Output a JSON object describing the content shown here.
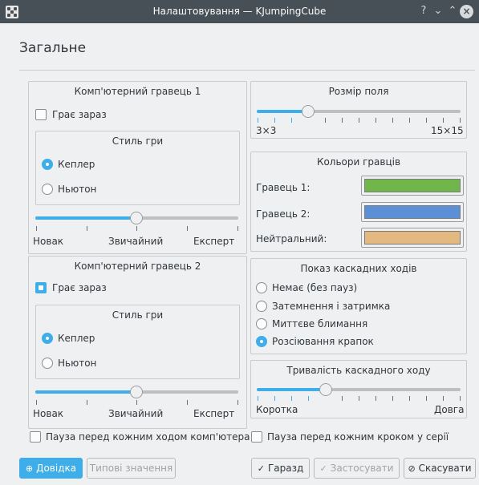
{
  "window": {
    "title": "Налаштовування — KJumpingCube",
    "help_glyph": "?",
    "minimize_glyph": "⌄",
    "maximize_glyph": "⌃",
    "close_glyph": "×"
  },
  "heading": "Загальне",
  "computer_player_1": {
    "title": "Комп'ютерний гравець 1",
    "plays_now_label": "Грає зараз",
    "plays_now_checked": false,
    "style_title": "Стиль гри",
    "options": [
      "Кеплер",
      "Ньютон"
    ],
    "selected": "Кеплер",
    "skill_min_label": "Новак",
    "skill_mid_label": "Звичайний",
    "skill_max_label": "Експерт",
    "skill_level_fraction": 0.5
  },
  "computer_player_2": {
    "title": "Комп'ютерний гравець 2",
    "plays_now_label": "Грає зараз",
    "plays_now_checked": true,
    "style_title": "Стиль гри",
    "options": [
      "Кеплер",
      "Ньютон"
    ],
    "selected": "Кеплер",
    "skill_min_label": "Новак",
    "skill_mid_label": "Звичайний",
    "skill_max_label": "Експерт",
    "skill_level_fraction": 0.5
  },
  "board_size": {
    "title": "Розмір поля",
    "min_label": "3×3",
    "max_label": "15×15",
    "value_fraction": 0.25
  },
  "player_colors": {
    "title": "Кольори гравців",
    "player1_label": "Гравець 1:",
    "player1_color": "#71b64b",
    "player2_label": "Гравець 2:",
    "player2_color": "#5b8fd6",
    "neutral_label": "Нейтральний:",
    "neutral_color": "#e3b980"
  },
  "cascade_display": {
    "title": "Показ каскадних ходів",
    "options": [
      "Немає (без пауз)",
      "Затемнення і затримка",
      "Миттєве блимання",
      "Розсіювання крапок"
    ],
    "selected": "Розсіювання крапок"
  },
  "cascade_duration": {
    "title": "Тривалість каскадного ходу",
    "min_label": "Коротка",
    "max_label": "Довга",
    "value_fraction": 0.3333
  },
  "pause_before_computer_move": {
    "label": "Пауза перед кожним ходом комп'ютера",
    "checked": false
  },
  "pause_before_each_step": {
    "label": "Пауза перед кожним кроком у серії",
    "checked": false
  },
  "buttons": {
    "help": "Довідка",
    "defaults": "Типові значення",
    "ok": "Гаразд",
    "apply": "Застосувати",
    "cancel": "Скасувати"
  },
  "colors": {
    "accent": "#3daee9",
    "titlebar": "#475057",
    "background": "#eff0f1"
  }
}
